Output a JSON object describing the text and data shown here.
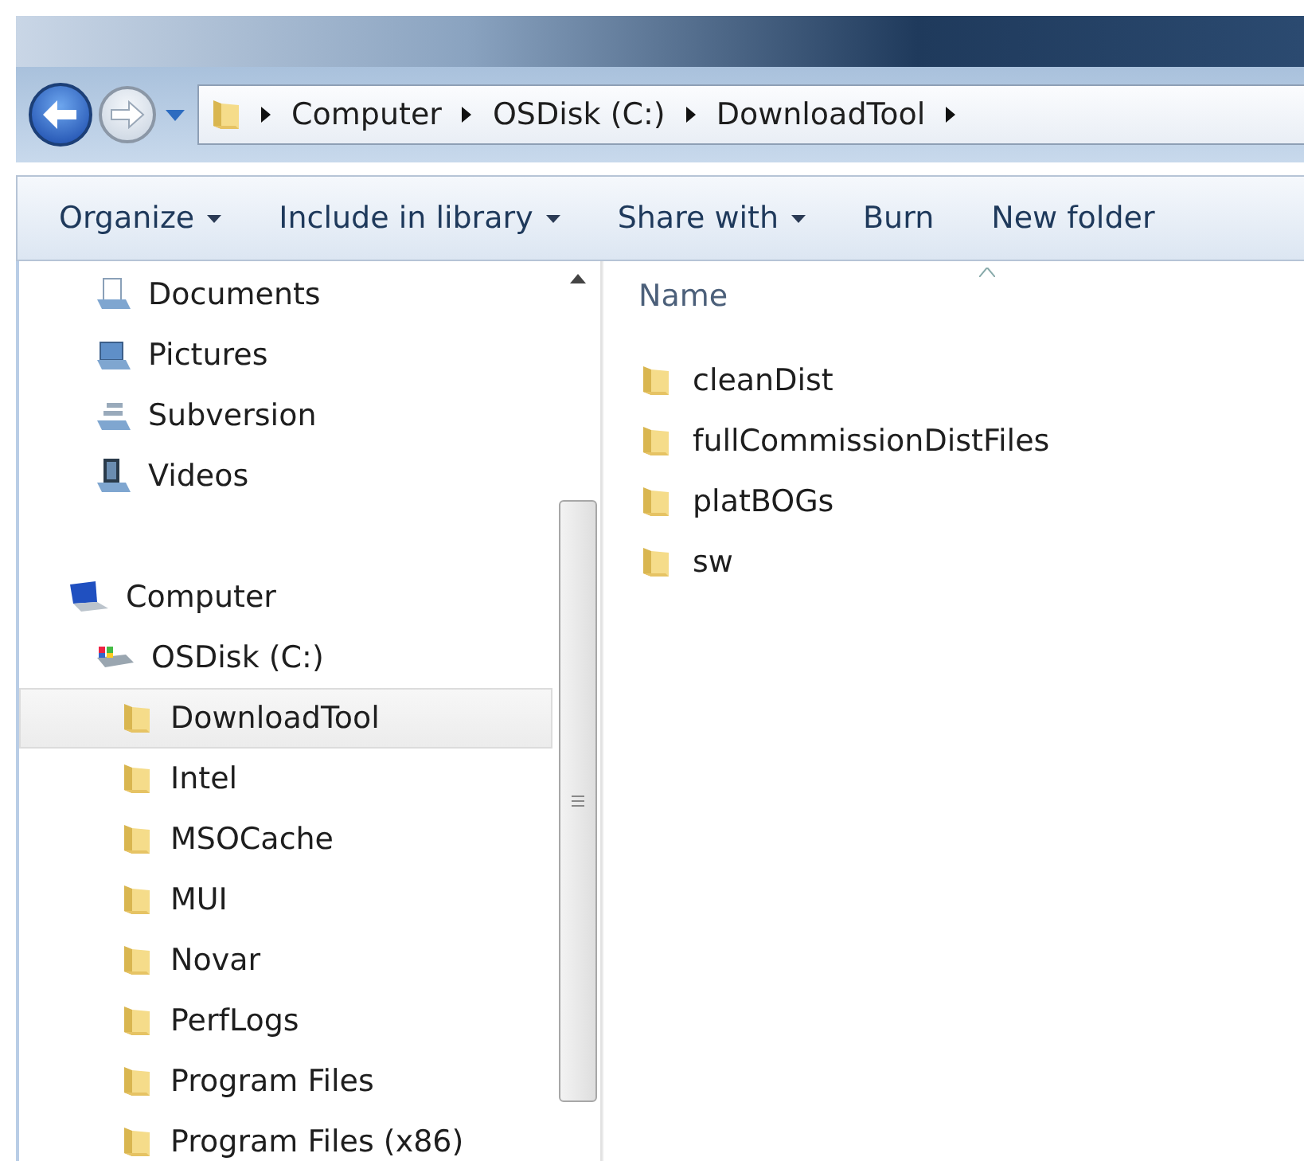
{
  "address": {
    "crumbs": [
      "Computer",
      "OSDisk (C:)",
      "DownloadTool"
    ]
  },
  "toolbar": [
    {
      "label": "Organize",
      "menu": true
    },
    {
      "label": "Include in library",
      "menu": true
    },
    {
      "label": "Share with",
      "menu": true
    },
    {
      "label": "Burn",
      "menu": false
    },
    {
      "label": "New folder",
      "menu": false
    }
  ],
  "nav": {
    "libraries": [
      {
        "label": "Documents",
        "kind": "documents",
        "selected": false
      },
      {
        "label": "Pictures",
        "kind": "pictures",
        "selected": false
      },
      {
        "label": "Subversion",
        "kind": "library",
        "selected": false
      },
      {
        "label": "Videos",
        "kind": "videos",
        "selected": false
      }
    ],
    "tree": [
      {
        "label": "Computer",
        "kind": "computer",
        "selected": false,
        "children": [
          {
            "label": "OSDisk (C:)",
            "kind": "drive",
            "selected": false,
            "children": [
              {
                "label": "DownloadTool",
                "kind": "folder",
                "selected": true
              },
              {
                "label": "Intel",
                "kind": "folder",
                "selected": false
              },
              {
                "label": "MSOCache",
                "kind": "folder",
                "selected": false
              },
              {
                "label": "MUI",
                "kind": "folder",
                "selected": false
              },
              {
                "label": "Novar",
                "kind": "folder",
                "selected": false
              },
              {
                "label": "PerfLogs",
                "kind": "folder",
                "selected": false
              },
              {
                "label": "Program Files",
                "kind": "folder",
                "selected": false
              },
              {
                "label": "Program Files (x86)",
                "kind": "folder",
                "selected": false
              }
            ]
          }
        ]
      }
    ]
  },
  "content": {
    "columns": [
      {
        "label": "Name",
        "sorted": true
      }
    ],
    "items": [
      {
        "name": "cleanDist"
      },
      {
        "name": "fullCommissionDistFiles"
      },
      {
        "name": "platBOGs"
      },
      {
        "name": "sw"
      }
    ]
  }
}
